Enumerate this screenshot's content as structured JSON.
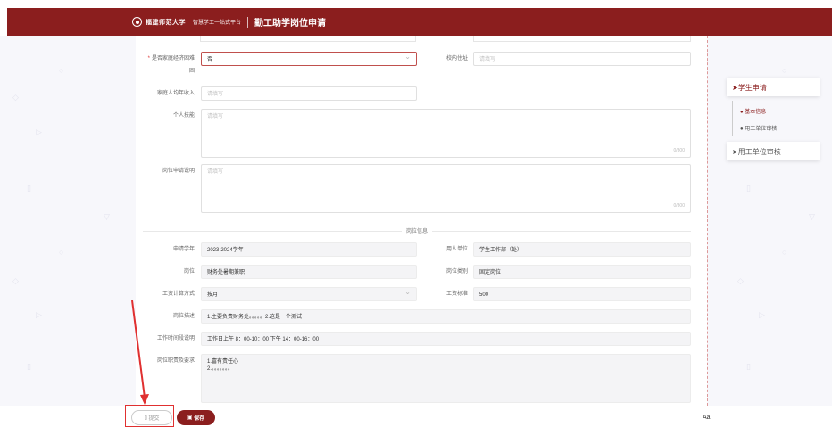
{
  "header": {
    "school": "福建师范大学",
    "platform": "智慧学工一站式平台",
    "title": "勤工助学岗位申请"
  },
  "form": {
    "poverty_label": "是否家庭经济困难",
    "poverty_value": "否",
    "campus_addr_label": "校内住址",
    "campus_addr_ph": "请填写",
    "income_label": "家庭人均年收入",
    "income_ph": "请填写",
    "skills_label": "个人技能",
    "skills_ph": "请填写",
    "skills_count": "0/300",
    "apply_desc_label": "岗位申请说明",
    "apply_desc_ph": "请填写",
    "apply_desc_count": "0/300"
  },
  "section_title": "岗位信息",
  "job": {
    "year_label": "申请学年",
    "year_value": "2023-2024学年",
    "employer_label": "用人单位",
    "employer_value": "学生工作部（处）",
    "post_label": "岗位",
    "post_value": "财务处暑期兼职",
    "category_label": "岗位类别",
    "category_value": "固定岗位",
    "wage_method_label": "工资计算方式",
    "wage_method_value": "按月",
    "wage_std_label": "工资标准",
    "wage_std_value": "500",
    "desc_label": "岗位描述",
    "desc_value": "1.主要负责财务处。。。。。2.这是一个测试",
    "time_label": "工作时间段说明",
    "time_value": "工作日上午 8：00-10：00   下午 14：00-16：00",
    "duty_label": "岗位职责及要求",
    "duty_line1": "1.富有责任心",
    "duty_line2": "2.。。。。。。。"
  },
  "sidebar": {
    "student_apply": "学生申请",
    "basic_info": "基本信息",
    "employer_review_sub": "用工单位审核",
    "employer_review": "用工单位审核"
  },
  "footer": {
    "submit": "提交",
    "save": "保存",
    "aa": "Aa"
  },
  "colors": {
    "brand": "#8b1e1e",
    "highlight": "#e03030"
  }
}
